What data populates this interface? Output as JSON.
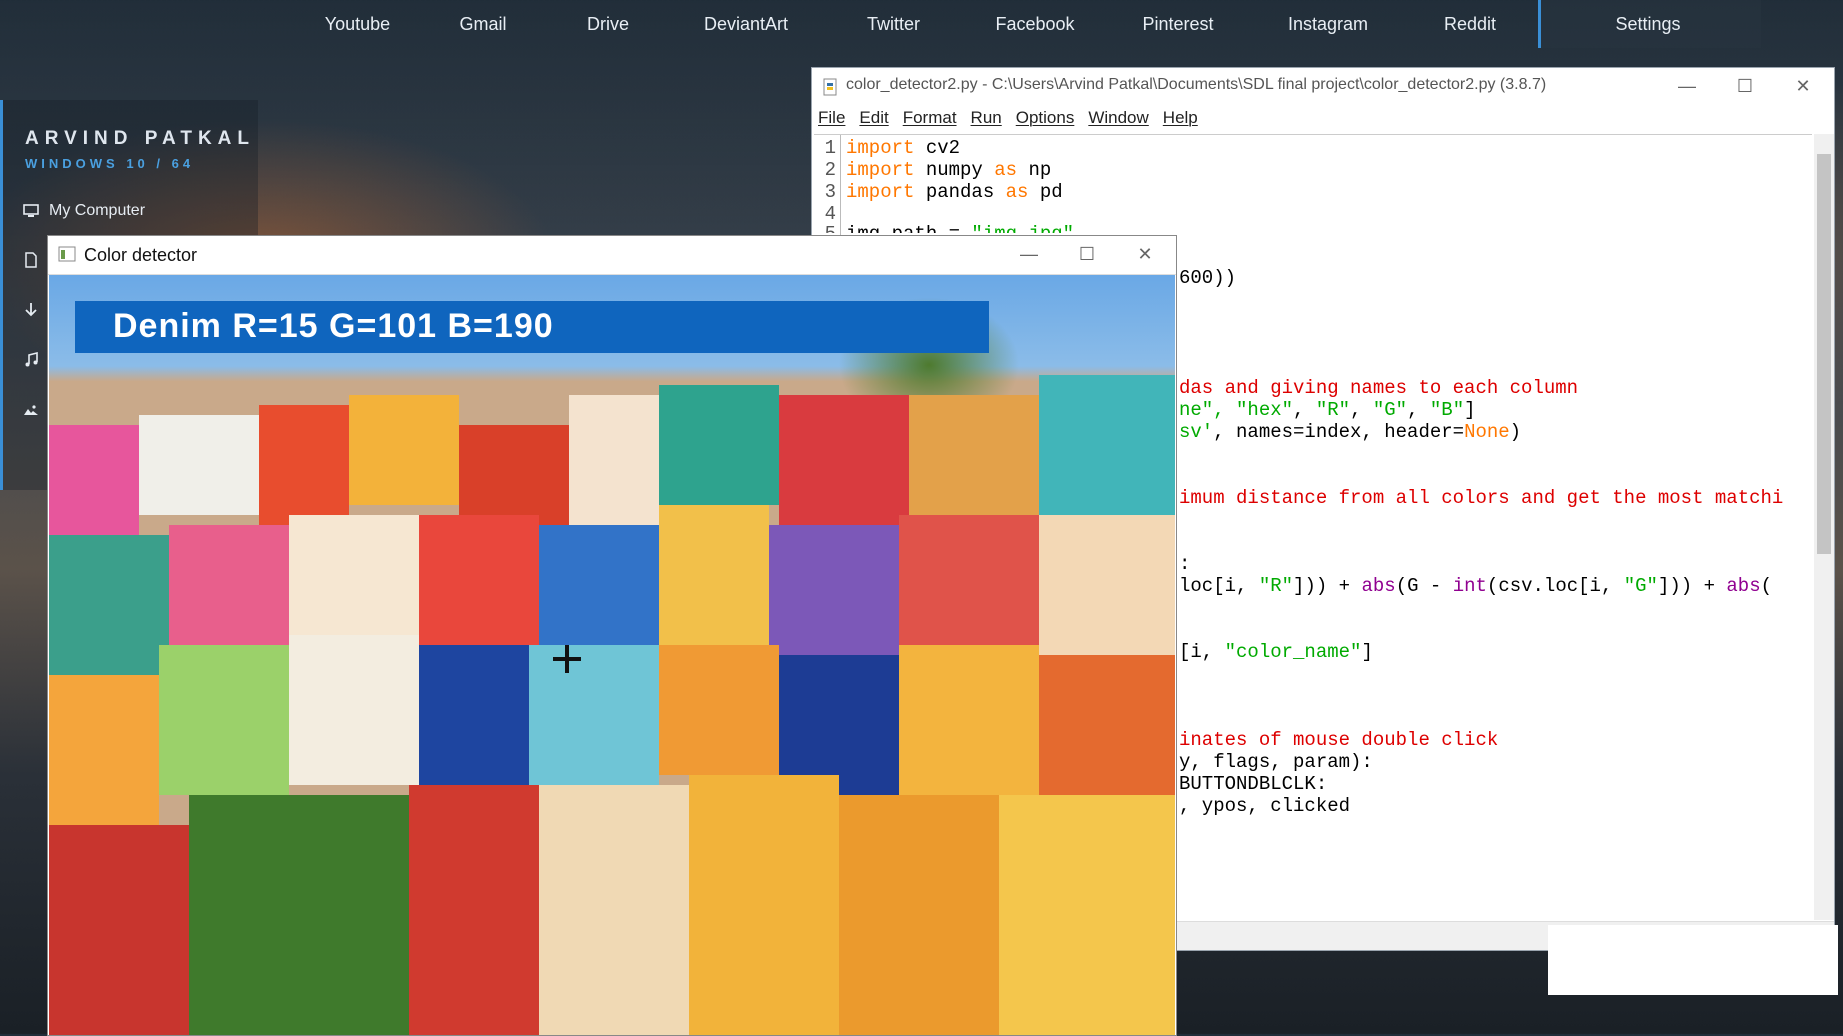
{
  "topbar": {
    "links": [
      "Youtube",
      "Gmail",
      "Drive",
      "DeviantArt",
      "Twitter",
      "Facebook",
      "Pinterest",
      "Instagram",
      "Reddit"
    ],
    "settings": "Settings"
  },
  "sidebar": {
    "name": "ARVIND PATKAL",
    "subtitle": "WINDOWS 10 / 64",
    "items": [
      {
        "label": "My Computer",
        "icon": "monitor-icon"
      },
      {
        "label": "",
        "icon": "document-icon"
      },
      {
        "label": "",
        "icon": "download-icon"
      },
      {
        "label": "",
        "icon": "music-icon"
      },
      {
        "label": "",
        "icon": "image-icon"
      }
    ]
  },
  "idle": {
    "title": "color_detector2.py - C:\\Users\\Arvind Patkal\\Documents\\SDL final project\\color_detector2.py (3.8.7)",
    "menu": [
      "File",
      "Edit",
      "Format",
      "Run",
      "Options",
      "Window",
      "Help"
    ],
    "line_numbers": [
      "1",
      "2",
      "3",
      "4",
      "5"
    ],
    "code": {
      "l1_kw": "import",
      "l1_rest": " cv2",
      "l2_kw": "import",
      "l2_mid": " numpy ",
      "l2_as": "as",
      "l2_rest": " np",
      "l3_kw": "import",
      "l3_mid": " pandas ",
      "l3_as": "as",
      "l3_rest": " pd",
      "l5": "img_path = ",
      "l5_str": "\"img.jpg\"",
      "c1": "600))",
      "c2_cm": "das and giving names to each column",
      "c3_a": "ne\", ",
      "c3_b": "\"hex\"",
      "c3_c": ", ",
      "c3_d": "\"R\"",
      "c3_e": ", ",
      "c3_f": "\"G\"",
      "c3_g": ", ",
      "c3_h": "\"B\"",
      "c3_i": "]",
      "c4_a": "sv'",
      "c4_b": ", names=index, header=",
      "c4_c": "None",
      "c4_d": ")",
      "c5_cm": "imum distance from all colors and get the most matchi",
      "c6": ":",
      "c7_a": "loc[i, ",
      "c7_b": "\"R\"",
      "c7_c": "])) + ",
      "c7_d": "abs",
      "c7_e": "(G - ",
      "c7_f": "int",
      "c7_g": "(csv.loc[i, ",
      "c7_h": "\"G\"",
      "c7_i": "])) + ",
      "c7_j": "abs",
      "c7_k": "(",
      "c8_a": "[i, ",
      "c8_b": "\"color_name\"",
      "c8_c": "]",
      "c9_cm": "inates of mouse double click",
      "c10": "y, flags, param):",
      "c11": "BUTTONDBLCLK:",
      "c12": ", ypos, clicked"
    }
  },
  "detector": {
    "title": "Color detector",
    "label": "Denim R=15 G=101 B=190",
    "banner_color": "#0f65be"
  }
}
